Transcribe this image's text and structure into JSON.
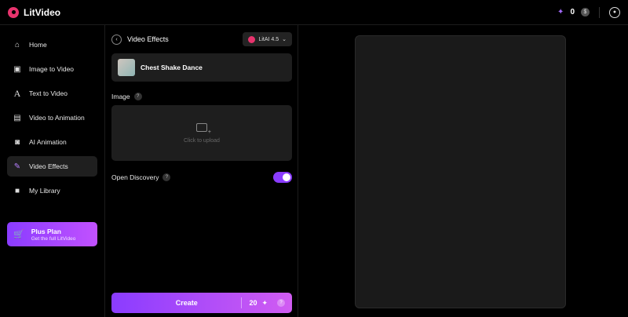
{
  "app": {
    "name": "LitVideo"
  },
  "topbar": {
    "credits": "0"
  },
  "sidebar": {
    "items": [
      {
        "label": "Home",
        "icon": "home-icon"
      },
      {
        "label": "Image to Video",
        "icon": "image-icon"
      },
      {
        "label": "Text to Video",
        "icon": "text-icon"
      },
      {
        "label": "Video to Animation",
        "icon": "film-icon"
      },
      {
        "label": "AI Animation",
        "icon": "robot-icon"
      },
      {
        "label": "Video Effects",
        "icon": "wand-icon",
        "active": true
      },
      {
        "label": "My Library",
        "icon": "folder-icon"
      }
    ],
    "plan": {
      "title": "Plus Plan",
      "subtitle": "Get the full LitVideo"
    }
  },
  "panel": {
    "title": "Video Effects",
    "model": "LitAI 4.5",
    "effect_name": "Chest Shake Dance",
    "image_label": "Image",
    "upload_text": "Click to upload",
    "discovery_label": "Open Discovery",
    "discovery_on": true,
    "create_label": "Create",
    "create_cost": "20"
  },
  "colors": {
    "accent": "#8a3cff",
    "brand": "#e8336d",
    "bg": "#000000",
    "card": "#1e1e1e"
  }
}
